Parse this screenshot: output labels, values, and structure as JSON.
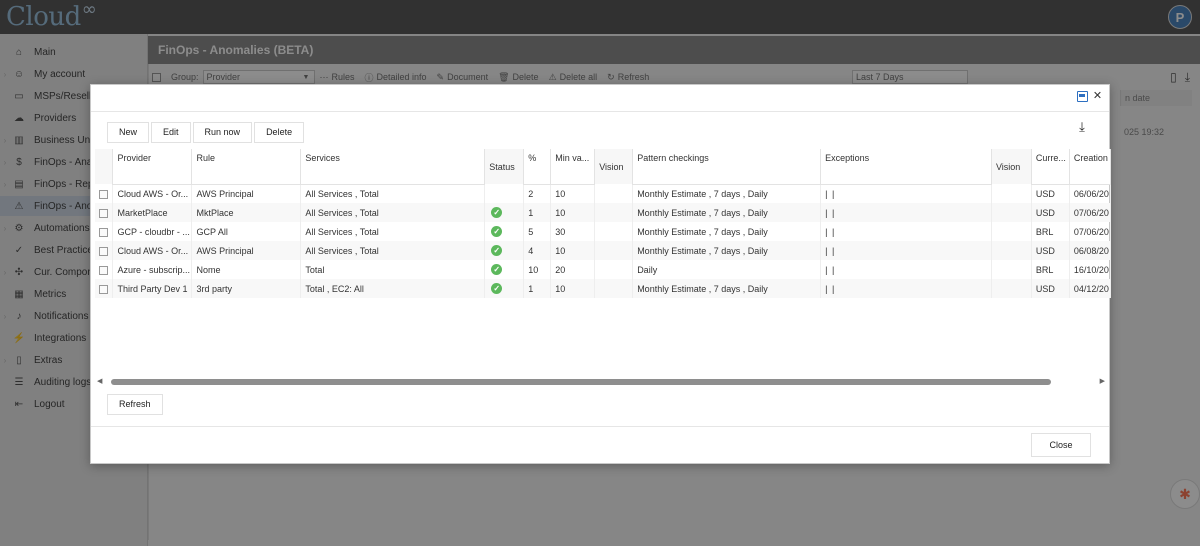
{
  "app": {
    "logo_text": "Cloud",
    "logo_symbol": "∞",
    "avatar_initial": "P"
  },
  "sidebar": {
    "items": [
      {
        "label": "Main",
        "icon": "home-icon"
      },
      {
        "label": "My account",
        "icon": "user-icon"
      },
      {
        "label": "MSPs/Reseller",
        "icon": "briefcase-icon"
      },
      {
        "label": "Providers",
        "icon": "cloud-icon"
      },
      {
        "label": "Business Unit",
        "icon": "building-icon"
      },
      {
        "label": "FinOps - Ana",
        "icon": "dollar-icon"
      },
      {
        "label": "FinOps - Rep",
        "icon": "report-icon"
      },
      {
        "label": "FinOps - Ano",
        "icon": "warning-icon"
      },
      {
        "label": "Automations",
        "icon": "gear-icon"
      },
      {
        "label": "Best Practices",
        "icon": "check-icon"
      },
      {
        "label": "Cur. Compon",
        "icon": "puzzle-icon"
      },
      {
        "label": "Metrics",
        "icon": "chart-icon"
      },
      {
        "label": "Notifications",
        "icon": "bell-icon"
      },
      {
        "label": "Integrations",
        "icon": "plug-icon"
      },
      {
        "label": "Extras",
        "icon": "book-icon"
      },
      {
        "label": "Auditing logs",
        "icon": "list-icon"
      },
      {
        "label": "Logout",
        "icon": "logout-icon"
      }
    ]
  },
  "page": {
    "title": "FinOps - Anomalies (BETA)",
    "toolbar": {
      "group_label": "Group:",
      "group_value": "Provider",
      "rules": "Rules",
      "detailed_info": "Detailed info",
      "document": "Document",
      "delete": "Delete",
      "delete_all": "Delete all",
      "refresh": "Refresh",
      "period": "Last 7 Days"
    },
    "behind_column_header": "n date",
    "behind_cell": "025 19:32"
  },
  "modal": {
    "buttons": {
      "new": "New",
      "edit": "Edit",
      "run_now": "Run now",
      "delete": "Delete",
      "refresh": "Refresh",
      "close": "Close"
    },
    "columns": {
      "provider": "Provider",
      "rule": "Rule",
      "services": "Services",
      "status": "Status",
      "percent": "%",
      "min_value": "Min va...",
      "vision": "Vision",
      "pattern": "Pattern checkings",
      "exceptions": "Exceptions",
      "vision2": "Vision",
      "currency": "Curre...",
      "creation": "Creation"
    },
    "rows": [
      {
        "provider": "Cloud AWS - Or...",
        "rule": "AWS Principal",
        "services": "All Services , Total",
        "status": "",
        "percent": "2",
        "min_value": "10",
        "vision": "",
        "pattern": "Monthly Estimate , 7 days , Daily",
        "exceptions": "| |",
        "vision2": "",
        "currency": "USD",
        "creation": "06/06/20"
      },
      {
        "provider": "MarketPlace",
        "rule": "MktPlace",
        "services": "All Services , Total",
        "status": "ok",
        "percent": "1",
        "min_value": "10",
        "vision": "",
        "pattern": "Monthly Estimate , 7 days , Daily",
        "exceptions": "| |",
        "vision2": "",
        "currency": "USD",
        "creation": "07/06/20"
      },
      {
        "provider": "GCP - cloudbr - ...",
        "rule": "GCP All",
        "services": "All Services , Total",
        "status": "ok",
        "percent": "5",
        "min_value": "30",
        "vision": "",
        "pattern": "Monthly Estimate , 7 days , Daily",
        "exceptions": "| |",
        "vision2": "",
        "currency": "BRL",
        "creation": "07/06/20"
      },
      {
        "provider": "Cloud AWS - Or...",
        "rule": "AWS Principal",
        "services": "All Services , Total",
        "status": "ok",
        "percent": "4",
        "min_value": "10",
        "vision": "",
        "pattern": "Monthly Estimate , 7 days , Daily",
        "exceptions": "| |",
        "vision2": "",
        "currency": "USD",
        "creation": "06/08/20"
      },
      {
        "provider": "Azure - subscrip...",
        "rule": "Nome",
        "services": "Total",
        "status": "ok",
        "percent": "10",
        "min_value": "20",
        "vision": "",
        "pattern": "Daily",
        "exceptions": "| |",
        "vision2": "",
        "currency": "BRL",
        "creation": "16/10/20"
      },
      {
        "provider": "Third Party Dev 1",
        "rule": "3rd party",
        "services": "Total , EC2: All",
        "status": "ok",
        "percent": "1",
        "min_value": "10",
        "vision": "",
        "pattern": "Monthly Estimate , 7 days , Daily",
        "exceptions": "| |",
        "vision2": "",
        "currency": "USD",
        "creation": "04/12/20"
      }
    ]
  }
}
